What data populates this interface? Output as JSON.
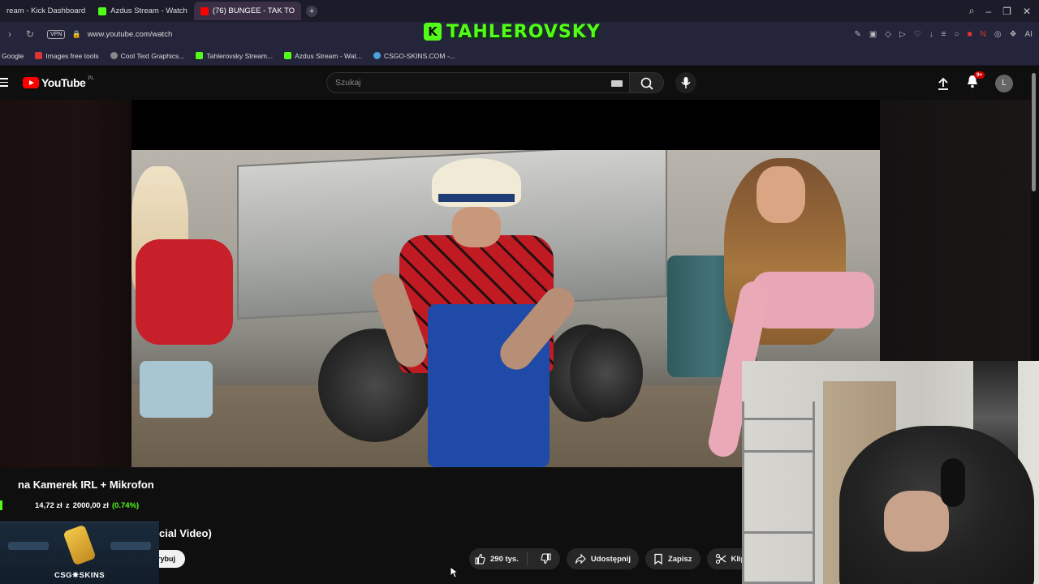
{
  "browser": {
    "tabs": [
      {
        "label": "ream - Kick Dashboard",
        "color": "#53fc18",
        "active": false
      },
      {
        "label": "Azdus Stream - Watch",
        "color": "#53fc18",
        "active": false
      },
      {
        "label": "(76) BUNGEE - TAK TO",
        "color": "#ff0000",
        "active": true
      }
    ],
    "url": "www.youtube.com/watch",
    "vpn_label": "VPN",
    "bookmarks": [
      {
        "label": "Google",
        "color": "#4285f4"
      },
      {
        "label": "Images free tools",
        "color": "#d33"
      },
      {
        "label": "Cool Text Graphics...",
        "color": "#888"
      },
      {
        "label": "Tahlerovsky Stream...",
        "color": "#53fc18"
      },
      {
        "label": "Azdus Stream - Wat...",
        "color": "#53fc18"
      },
      {
        "label": "CSGO-SKINS.COM -...",
        "color": "#4aa3df"
      }
    ]
  },
  "overlay": {
    "logo_letter": "K",
    "channel_name": "TAHLEROVSKY"
  },
  "youtube": {
    "logo_text": "YouTube",
    "country_code": "PL",
    "search_placeholder": "Szukaj",
    "notification_count": "9+",
    "avatar_letter": "L",
    "video_title": "cial Video)",
    "subscribe_label": "rybuj",
    "likes_count": "290 tys.",
    "share_label": "Udostępnij",
    "save_label": "Zapisz",
    "clip_label": "Klip"
  },
  "donation": {
    "title": "na Kamerek IRL + Mikrofon",
    "current": "14,72 zł",
    "separator": "z",
    "goal": "2000,00 zł",
    "percent": "(0.74%)",
    "progress_fraction": 0.0074
  },
  "sponsor": {
    "label": "CSG✵SKINS"
  },
  "colors": {
    "kick_green": "#53fc18",
    "youtube_red": "#ff0000",
    "background": "#0f0f0f"
  }
}
